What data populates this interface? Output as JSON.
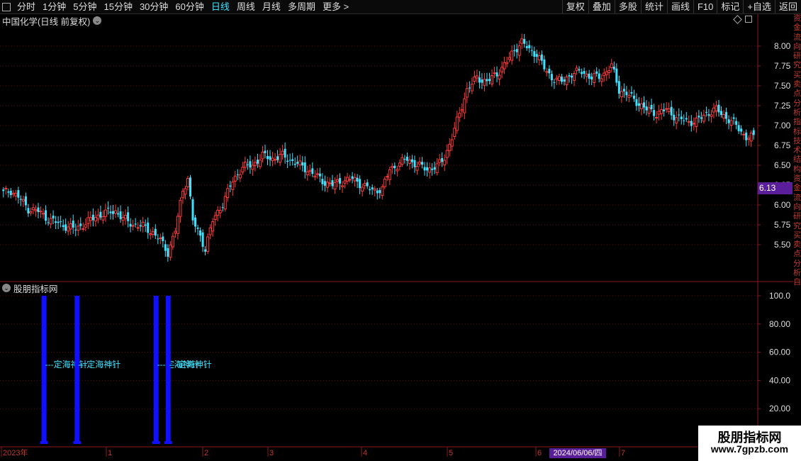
{
  "toolbar": {
    "periods": [
      "分时",
      "1分钟",
      "5分钟",
      "15分钟",
      "30分钟",
      "60分钟",
      "日线",
      "周线",
      "月线",
      "多周期",
      "更多 >"
    ],
    "active_period": "日线",
    "right_buttons": [
      "复权",
      "叠加",
      "多股",
      "统计",
      "画线",
      "F10",
      "标记",
      "+自选",
      "返回"
    ]
  },
  "main_chart": {
    "title": "中国化学(日线 前复权)",
    "price_tag": "6.13",
    "y_ticks": [
      "8.00",
      "7.75",
      "7.50",
      "7.25",
      "7.00",
      "6.75",
      "6.50",
      "6.25",
      "6.00",
      "5.75",
      "5.50"
    ],
    "colors": {
      "up": "#ff3b3b",
      "down": "#3ee2ff",
      "grid": "#5a1010",
      "border": "#8a1a1a",
      "axis_text": "#dddddd"
    }
  },
  "indicator": {
    "title": "股朋指标网",
    "y_ticks": [
      "100.0",
      "80.00",
      "60.00",
      "40.00",
      "20.00"
    ],
    "signal_label": "---定海神针",
    "bar_color": "#1010ff",
    "label_color": "#3ee2ff"
  },
  "time_axis": {
    "labels": [
      "2023年",
      "1",
      "2",
      "3",
      "4",
      "5",
      "6",
      "7"
    ],
    "cursor_date": "2024/06/06/四"
  },
  "side_strip": {
    "text": "资金流向研究买卖点分析指标技术结构资金流向研究买卖点分析自"
  },
  "watermark": {
    "line1": "股朋指标网",
    "line2": "www.7gpzb.com"
  },
  "chart_data": {
    "type": "candlestick",
    "title": "中国化学(日线 前复权)",
    "ylim": [
      5.25,
      8.2
    ],
    "y_ticks": [
      5.5,
      5.75,
      6.0,
      6.25,
      6.5,
      6.75,
      7.0,
      7.25,
      7.5,
      7.75,
      8.0
    ],
    "x_labels": [
      "2023年",
      "1",
      "2",
      "3",
      "4",
      "5",
      "6",
      "7"
    ],
    "close_anchors": [
      [
        0,
        6.15
      ],
      [
        3,
        6.18
      ],
      [
        6,
        6.1
      ],
      [
        10,
        5.95
      ],
      [
        14,
        5.92
      ],
      [
        18,
        5.82
      ],
      [
        22,
        5.77
      ],
      [
        26,
        5.72
      ],
      [
        29,
        5.7
      ],
      [
        33,
        5.77
      ],
      [
        37,
        5.85
      ],
      [
        41,
        5.9
      ],
      [
        45,
        5.92
      ],
      [
        48,
        5.83
      ],
      [
        52,
        5.75
      ],
      [
        56,
        5.73
      ],
      [
        60,
        5.65
      ],
      [
        63,
        5.55
      ],
      [
        66,
        5.4
      ],
      [
        69,
        5.68
      ],
      [
        72,
        6.18
      ],
      [
        74,
        6.35
      ],
      [
        76,
        5.8
      ],
      [
        79,
        5.6
      ],
      [
        81,
        5.45
      ],
      [
        84,
        5.8
      ],
      [
        88,
        6.02
      ],
      [
        92,
        6.3
      ],
      [
        96,
        6.48
      ],
      [
        100,
        6.5
      ],
      [
        104,
        6.62
      ],
      [
        108,
        6.58
      ],
      [
        112,
        6.62
      ],
      [
        116,
        6.55
      ],
      [
        120,
        6.48
      ],
      [
        124,
        6.4
      ],
      [
        128,
        6.3
      ],
      [
        132,
        6.25
      ],
      [
        136,
        6.3
      ],
      [
        140,
        6.33
      ],
      [
        144,
        6.25
      ],
      [
        148,
        6.18
      ],
      [
        152,
        6.2
      ],
      [
        155,
        6.45
      ],
      [
        158,
        6.5
      ],
      [
        162,
        6.58
      ],
      [
        166,
        6.5
      ],
      [
        170,
        6.45
      ],
      [
        174,
        6.48
      ],
      [
        177,
        6.6
      ],
      [
        180,
        6.85
      ],
      [
        183,
        7.15
      ],
      [
        186,
        7.45
      ],
      [
        190,
        7.6
      ],
      [
        194,
        7.55
      ],
      [
        198,
        7.65
      ],
      [
        202,
        7.8
      ],
      [
        205,
        7.95
      ],
      [
        208,
        8.05
      ],
      [
        211,
        7.95
      ],
      [
        214,
        7.9
      ],
      [
        217,
        7.72
      ],
      [
        220,
        7.6
      ],
      [
        224,
        7.55
      ],
      [
        228,
        7.65
      ],
      [
        232,
        7.68
      ],
      [
        236,
        7.6
      ],
      [
        240,
        7.62
      ],
      [
        244,
        7.75
      ],
      [
        247,
        7.45
      ],
      [
        250,
        7.4
      ],
      [
        254,
        7.3
      ],
      [
        258,
        7.2
      ],
      [
        262,
        7.15
      ],
      [
        266,
        7.2
      ],
      [
        270,
        7.1
      ],
      [
        274,
        7.05
      ],
      [
        278,
        7.05
      ],
      [
        282,
        7.15
      ],
      [
        286,
        7.2
      ],
      [
        290,
        7.1
      ],
      [
        294,
        7.0
      ],
      [
        298,
        6.85
      ],
      [
        301,
        6.85
      ]
    ],
    "indicator": {
      "name": "股朋指标网",
      "signal": "定海神针",
      "ylim": [
        0,
        105
      ],
      "signal_value": 100,
      "signal_positions_fraction": [
        0.0577,
        0.1014,
        0.2057,
        0.2217
      ]
    }
  }
}
